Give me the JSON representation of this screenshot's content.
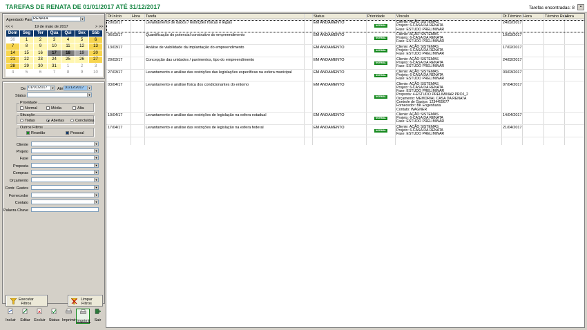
{
  "header": {
    "title": "TAREFAS DE RENATA DE 01/01/2017 ATÉ 31/12/2017",
    "count_label": "Tarefas encontradas:",
    "count": "8"
  },
  "agenda": {
    "label": "Agendado Para",
    "value": "RENATA"
  },
  "calendar": {
    "nav_prev_year": "<<",
    "nav_prev": "<",
    "day": "19",
    "de1": "de",
    "month": "maio",
    "de2": "de",
    "year": "2017",
    "nav_next": ">",
    "nav_next_year": ">>",
    "weekdays": [
      "Dom",
      "Seg",
      "Ter",
      "Qua",
      "Qui",
      "Sex",
      "Sáb"
    ],
    "weeks": [
      [
        "30",
        "1",
        "2",
        "3",
        "4",
        "5",
        "6"
      ],
      [
        "7",
        "8",
        "9",
        "10",
        "11",
        "12",
        "13"
      ],
      [
        "14",
        "15",
        "16",
        "17",
        "18",
        "19",
        "20"
      ],
      [
        "21",
        "22",
        "23",
        "24",
        "25",
        "26",
        "27"
      ],
      [
        "28",
        "29",
        "30",
        "31",
        "1",
        "2",
        "3"
      ],
      [
        "4",
        "5",
        "6",
        "7",
        "8",
        "9",
        "10"
      ]
    ]
  },
  "filters": {
    "de_label": "De",
    "de_value": "01/01/2017",
    "ate_label": "Até",
    "ate_value": "31/12/2017",
    "status_label": "Status",
    "prioridade": {
      "title": "Prioridade",
      "normal": "Normal",
      "media": "Média",
      "alta": "Alta"
    },
    "situacao": {
      "title": "Situação",
      "todas": "Todas",
      "abertas": "Abertas",
      "concluidas": "Concluídas"
    },
    "outros": {
      "title": "Outros Filtros",
      "reuniao": "Reunião",
      "pessoal": "Pessoal"
    },
    "fields": [
      "Cliente",
      "Projeto",
      "Fase",
      "Proposta",
      "Compras",
      "Orçamento",
      "Contr. Gastos",
      "Fornecedor",
      "Contato"
    ],
    "palavra_chave": "Palavra Chave"
  },
  "buttons": {
    "executar": "Executar\nFiltros",
    "executar1": "Executar",
    "executar2": "Filtros",
    "limpar1": "Limpar",
    "limpar2": "Filtros",
    "toolbar": [
      "Incluir",
      "Editar",
      "Excluir",
      "Status",
      "Imprimir",
      "Imprimir",
      "Sair"
    ]
  },
  "colors": {
    "title": "#1f8a4a",
    "calendar_header": "#10386b",
    "priority_badge": "#168a1f"
  },
  "table": {
    "columns": [
      "Dt.Início",
      "Hora",
      "Tarefa",
      "Status",
      "Prioridade",
      "Vínculo",
      "Dt.Término",
      "Hora",
      "Término Real",
      "Hora"
    ],
    "rows": [
      {
        "inicio": "20/02/17",
        "tarefa": "Levantamento de dados / restrições físicas e legais",
        "status": "EM ANDAMENTO",
        "prioridade": "NORMAL",
        "vinculo": [
          "Cliente: AÇÃO SISTEMAS",
          "Projeto: 6-CASA DA RENATA",
          "Fase: ESTUDO PRELIMINAR"
        ],
        "termino": "24/02/2017"
      },
      {
        "inicio": "06/03/17",
        "tarefa": "Quantificação do potencial construtivo do empreendimento",
        "status": "EM ANDAMENTO",
        "prioridade": "NORMAL",
        "vinculo": [
          "Cliente: AÇÃO SISTEMAS",
          "Projeto: 6-CASA DA RENATA",
          "Fase: ESTUDO PRELIMINAR"
        ],
        "termino": "10/03/2017"
      },
      {
        "inicio": "13/03/17",
        "tarefa": "Análise de viabilidade da implantação do empreendimento",
        "status": "EM ANDAMENTO",
        "prioridade": "NORMAL",
        "vinculo": [
          "Cliente: AÇÃO SISTEMAS",
          "Projeto: 6-CASA DA RENATA",
          "Fase: ESTUDO PRELIMINAR"
        ],
        "termino": "17/02/2017"
      },
      {
        "inicio": "20/03/17",
        "tarefa": "Concepção das unidades / pavimentos, tipo do empreendimento",
        "status": "EM ANDAMENTO",
        "prioridade": "NORMAL",
        "vinculo": [
          "Cliente: AÇÃO SISTEMAS",
          "Projeto: 6-CASA DA RENATA",
          "Fase: ESTUDO PRELIMINAR"
        ],
        "termino": "24/02/2017"
      },
      {
        "inicio": "27/03/17",
        "tarefa": "Levantamento e análise das restrições das legislações específicas na esfera municipal",
        "status": "EM ANDAMENTO",
        "prioridade": "NORMAL",
        "vinculo": [
          "Cliente: AÇÃO SISTEMAS",
          "Projeto: 6-CASA DA RENATA",
          "Fase: ESTUDO PRELIMINAR"
        ],
        "termino": "03/03/2017"
      },
      {
        "inicio": "03/04/17",
        "tarefa": "Levantamento e análise física dos condicionantes do entorno",
        "status": "EM ANDAMENTO",
        "prioridade": "NORMAL",
        "vinculo": [
          "Cliente: AÇÃO SISTEMAS",
          "Projeto: 6-CASA DA RENATA",
          "Fase: ESTUDO PRELIMINAR",
          "Proposta: 4-ESTUDO PRELIMINAR PROJ_2",
          "Orçamento: MEMORIAL CASA DA RENATA",
          "Controle de Gastos: 1234455677",
          "Fornecedor: BK Engenharia",
          "Contato: WAGNER"
        ],
        "termino": "07/04/2017"
      },
      {
        "inicio": "10/04/17",
        "tarefa": "Levantamento e análise das restrições de legislação na esfera estadual",
        "status": "EM ANDAMENTO",
        "prioridade": "NORMAL",
        "vinculo": [
          "Cliente: AÇÃO SISTEMAS",
          "Projeto: 6-CASA DA RENATA",
          "Fase: ESTUDO PRELIMINAR"
        ],
        "termino": "14/04/2017"
      },
      {
        "inicio": "17/04/17",
        "tarefa": "Levantamento e análise das restrições de legislação na esfera federal",
        "status": "EM ANDAMENTO",
        "prioridade": "NORMAL",
        "vinculo": [
          "Cliente: AÇÃO SISTEMAS",
          "Projeto: 6-CASA DA RENATA",
          "Fase: ESTUDO PRELIMINAR"
        ],
        "termino": "21/04/2017"
      }
    ]
  }
}
